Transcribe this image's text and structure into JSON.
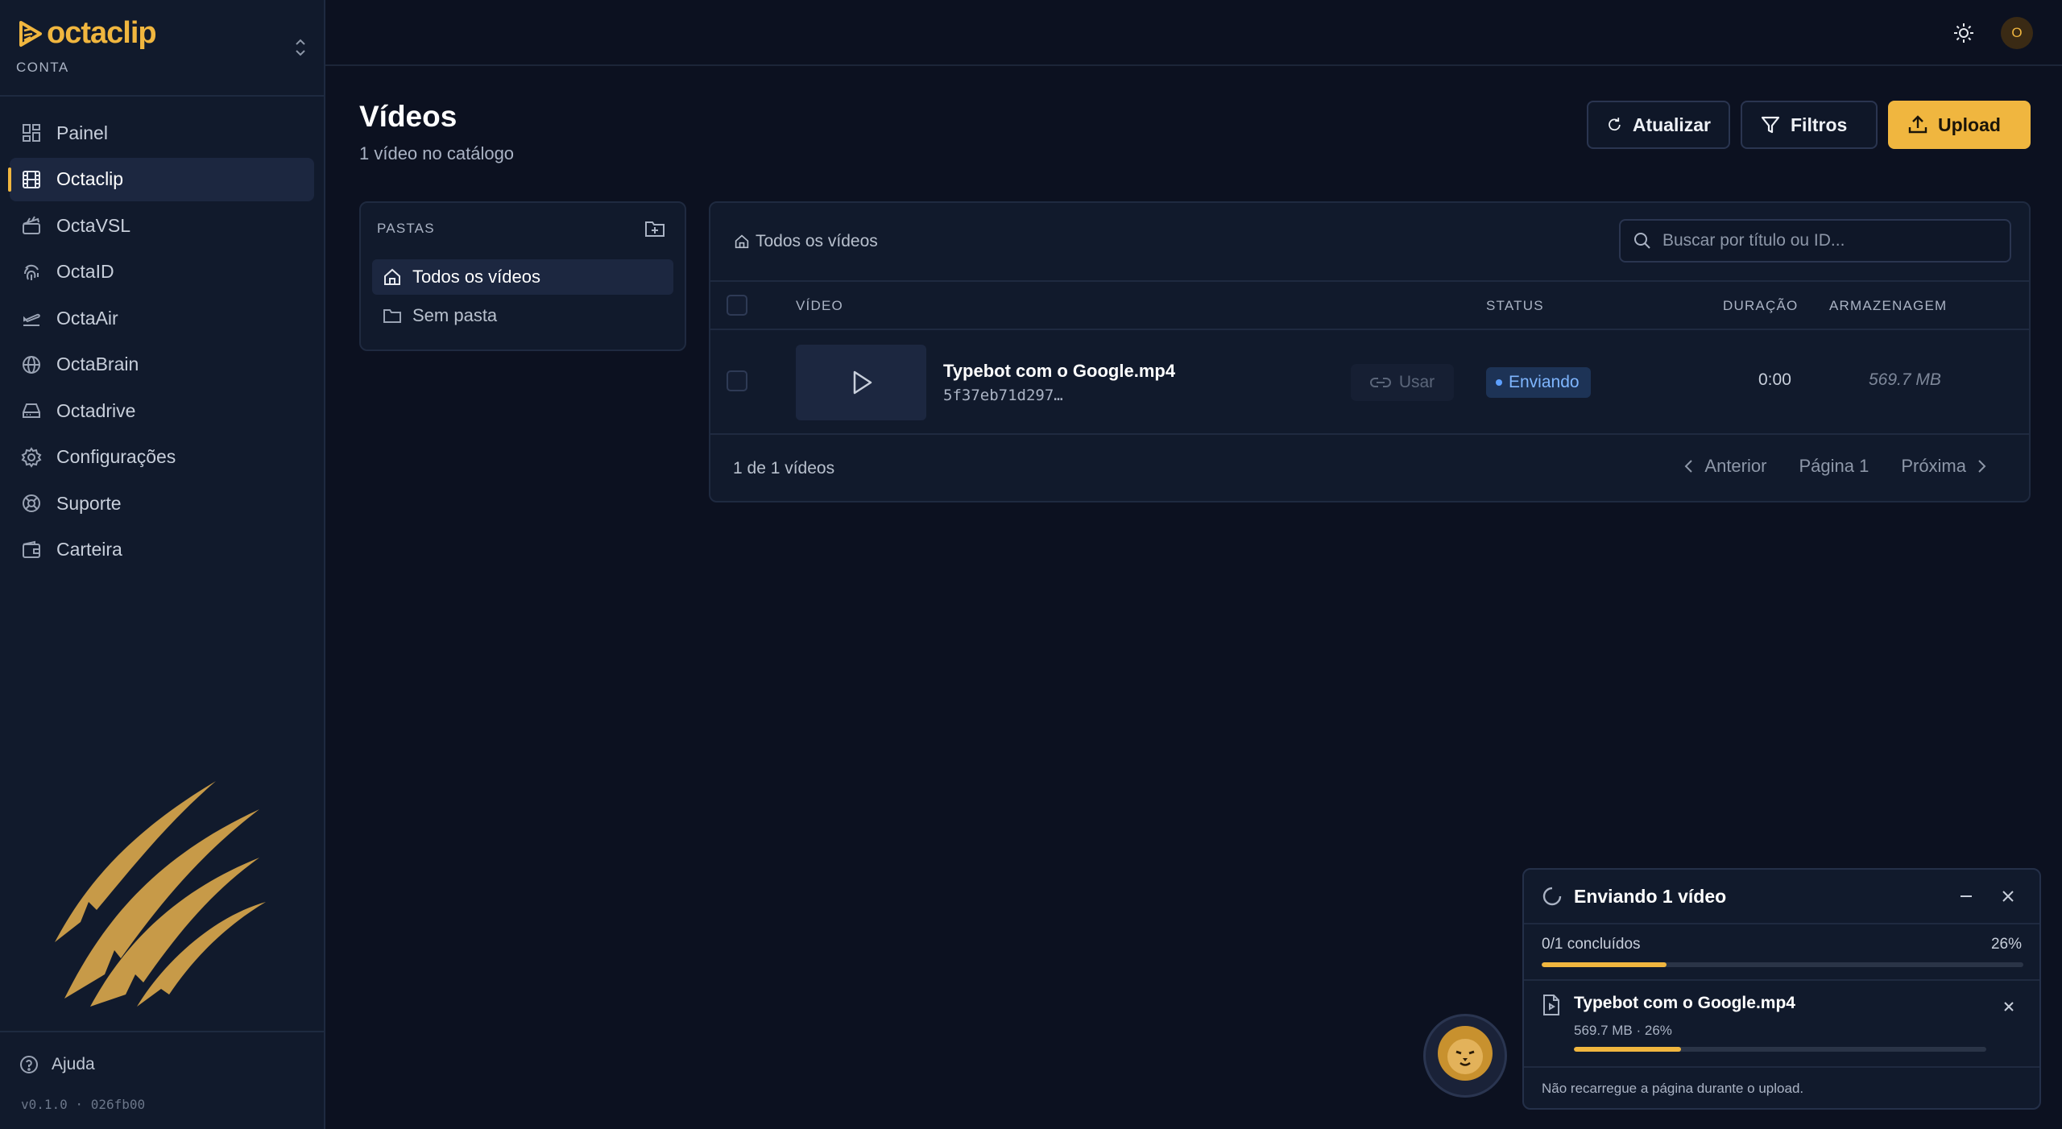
{
  "sidebar": {
    "brand": "octaclip",
    "account_label": "CONTA",
    "items": [
      {
        "label": "Painel",
        "icon": "dashboard-icon"
      },
      {
        "label": "Octaclip",
        "icon": "film-icon",
        "active": true
      },
      {
        "label": "OctaVSL",
        "icon": "clapperboard-icon"
      },
      {
        "label": "OctaID",
        "icon": "fingerprint-icon"
      },
      {
        "label": "OctaAir",
        "icon": "air-icon"
      },
      {
        "label": "OctaBrain",
        "icon": "globe-icon"
      },
      {
        "label": "Octadrive",
        "icon": "hard-drive-icon"
      },
      {
        "label": "Configurações",
        "icon": "gear-icon"
      },
      {
        "label": "Suporte",
        "icon": "lifebuoy-icon"
      },
      {
        "label": "Carteira",
        "icon": "wallet-icon"
      }
    ],
    "help_label": "Ajuda",
    "version": "v0.1.0 · 026fb00"
  },
  "topbar": {
    "avatar_initial": "O"
  },
  "header": {
    "title": "Vídeos",
    "subtitle": "1 vídeo no catálogo",
    "refresh_label": "Atualizar",
    "filter_label": "Filtros",
    "upload_label": "Upload"
  },
  "folders": {
    "title": "PASTAS",
    "items": [
      {
        "label": "Todos os vídeos",
        "active": true
      },
      {
        "label": "Sem pasta"
      }
    ]
  },
  "videos": {
    "breadcrumb": "Todos os vídeos",
    "search_placeholder": "Buscar por título ou ID...",
    "columns": {
      "video": "VÍDEO",
      "status": "STATUS",
      "duration": "DURAÇÃO",
      "storage": "ARMAZENAGEM"
    },
    "rows": [
      {
        "name": "Typebot com o Google.mp4",
        "id": "5f37eb71d297…",
        "use_label": "Usar",
        "status": "Enviando",
        "duration": "0:00",
        "storage": "569.7 MB"
      }
    ],
    "count_text": "1 de 1 vídeos",
    "prev_label": "Anterior",
    "page_label": "Página 1",
    "next_label": "Próxima"
  },
  "upload_toast": {
    "title": "Enviando 1 vídeo",
    "done_text": "0/1 concluídos",
    "percent_text": "26%",
    "progress": 0.26,
    "file": {
      "name": "Typebot com o Google.mp4",
      "meta": "569.7 MB  ·  26%",
      "progress": 0.26
    },
    "note": "Não recarregue a página durante o upload."
  },
  "colors": {
    "accent": "#f0b63f",
    "background": "#0c1120",
    "panel": "#111a2c",
    "status_blue": "#7fb6ff"
  }
}
